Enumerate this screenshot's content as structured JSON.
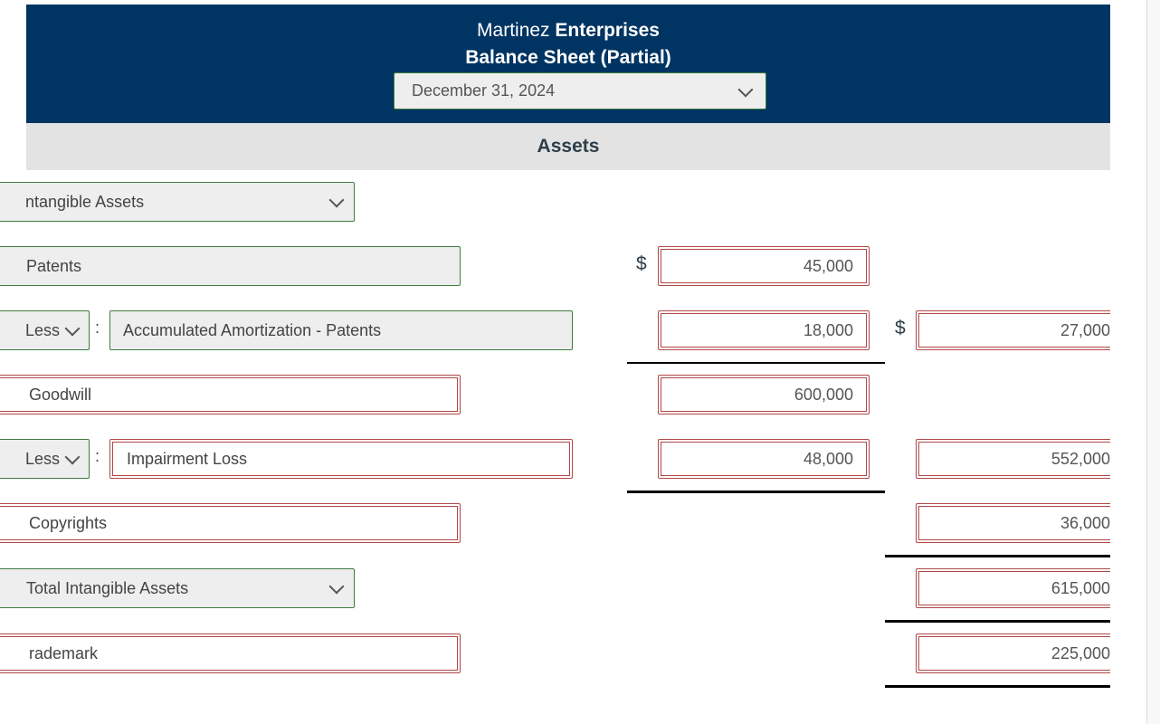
{
  "header": {
    "company_regular": "Martinez",
    "company_bold": "Enterprises",
    "statement_title": "Balance Sheet (Partial)",
    "date_select": {
      "value": "December 31, 2024",
      "icon": "chevron-down-icon"
    }
  },
  "section": {
    "title": "Assets"
  },
  "rows": [
    {
      "kind": "category-select",
      "label": "Intangible Assets",
      "label_visible": "ntangible Assets",
      "icon": "chevron-down-icon"
    },
    {
      "kind": "account",
      "label": "Patents",
      "col1_currency": "$",
      "col1_value": "45,000"
    },
    {
      "kind": "less-line",
      "operator": "Less",
      "separator": ":",
      "label": "Accumulated Amortization - Patents",
      "col1_value": "18,000",
      "col2_currency": "$",
      "col2_value": "27,000"
    },
    {
      "kind": "account",
      "label": "Goodwill",
      "col1_value": "600,000"
    },
    {
      "kind": "less-line",
      "operator": "Less",
      "separator": ":",
      "label": "Impairment Loss",
      "col1_value": "48,000",
      "col2_value": "552,000"
    },
    {
      "kind": "account",
      "label": "Copyrights",
      "col2_value": "36,000"
    },
    {
      "kind": "total-select",
      "label": "Total Intangible Assets",
      "icon": "chevron-down-icon",
      "col2_value": "615,000"
    },
    {
      "kind": "account",
      "label": "Trademark",
      "label_visible": "rademark",
      "col2_value": "225,000"
    }
  ],
  "colors": {
    "header_bg": "#003462",
    "band_bg": "#e3e3e3",
    "correct_border": "#3f7a3f",
    "incorrect_border": "#b04848"
  }
}
